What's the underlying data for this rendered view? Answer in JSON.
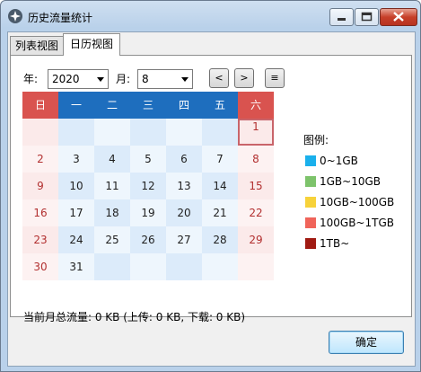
{
  "window": {
    "title": "历史流量统计"
  },
  "tabs": [
    {
      "label": "列表视图",
      "active": false
    },
    {
      "label": "日历视图",
      "active": true
    }
  ],
  "controls": {
    "year_label": "年:",
    "year_value": "2020",
    "month_label": "月:",
    "month_value": "8",
    "prev_label": "<",
    "next_label": ">",
    "menu_label": "≡"
  },
  "calendar": {
    "weekdays": [
      "日",
      "一",
      "二",
      "三",
      "四",
      "五",
      "六"
    ],
    "weekday_colors": [
      "#d9534f",
      "#1e6ebe",
      "#1e6ebe",
      "#1e6ebe",
      "#1e6ebe",
      "#1e6ebe",
      "#d9534f"
    ],
    "rows": [
      [
        "",
        "",
        "",
        "",
        "",
        "",
        "1"
      ],
      [
        "2",
        "3",
        "4",
        "5",
        "6",
        "7",
        "8"
      ],
      [
        "9",
        "10",
        "11",
        "12",
        "13",
        "14",
        "15"
      ],
      [
        "16",
        "17",
        "18",
        "19",
        "20",
        "21",
        "22"
      ],
      [
        "23",
        "24",
        "25",
        "26",
        "27",
        "28",
        "29"
      ],
      [
        "30",
        "31",
        "",
        "",
        "",
        "",
        ""
      ]
    ],
    "today": "1"
  },
  "legend": {
    "title": "图例:",
    "items": [
      {
        "label": "0~1GB",
        "color": "#1ab0ec"
      },
      {
        "label": "1GB~10GB",
        "color": "#7dc36b"
      },
      {
        "label": "10GB~100GB",
        "color": "#f7d23a"
      },
      {
        "label": "100GB~1TGB",
        "color": "#f0645a"
      },
      {
        "label": "1TB~",
        "color": "#a01a12"
      }
    ]
  },
  "summary": "当前月总流量: 0 KB (上传: 0 KB, 下载: 0 KB)",
  "ok_button": "确定"
}
